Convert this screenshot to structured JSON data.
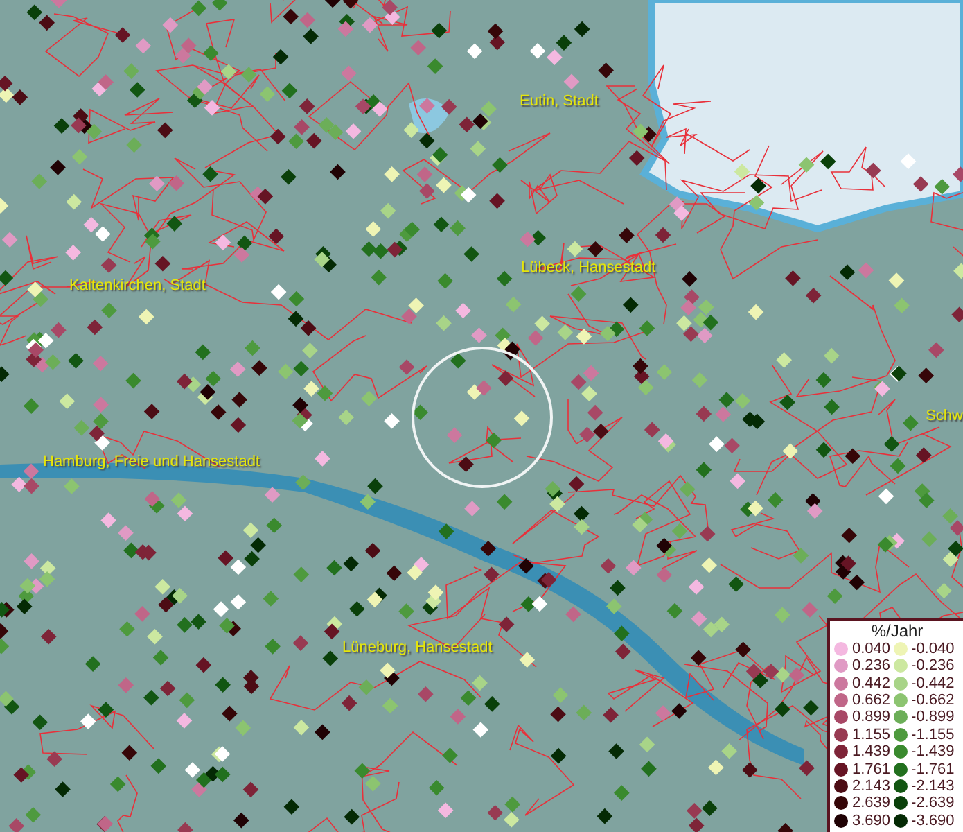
{
  "map": {
    "places": [
      {
        "name": "Eutin, Stadt"
      },
      {
        "name": "Lübeck, Hansestadt"
      },
      {
        "name": "Kaltenkirchen, Stadt"
      },
      {
        "name": "Hamburg, Freie und Hansestadt"
      },
      {
        "name": "Lüneburg, Hansestadt"
      },
      {
        "name": "Schw"
      }
    ]
  },
  "legend": {
    "title": "%/Jahr",
    "columns": [
      [
        {
          "label": "0.040",
          "color": "#f4b8e0"
        },
        {
          "label": "0.236",
          "color": "#e09ac4"
        },
        {
          "label": "0.442",
          "color": "#cc789e"
        },
        {
          "label": "0.662",
          "color": "#c06688"
        },
        {
          "label": "0.899",
          "color": "#a84866"
        },
        {
          "label": "1.155",
          "color": "#983a52"
        },
        {
          "label": "1.439",
          "color": "#7e2438"
        },
        {
          "label": "1.761",
          "color": "#661424"
        },
        {
          "label": "2.143",
          "color": "#4c0c14"
        },
        {
          "label": "2.639",
          "color": "#360608"
        },
        {
          "label": "3.690",
          "color": "#200204"
        }
      ],
      [
        {
          "label": "-0.040",
          "color": "#eef4b4"
        },
        {
          "label": "-0.236",
          "color": "#cce8a0"
        },
        {
          "label": "-0.442",
          "color": "#a8d488"
        },
        {
          "label": "-0.662",
          "color": "#8cc470"
        },
        {
          "label": "-0.899",
          "color": "#6cae58"
        },
        {
          "label": "-1.155",
          "color": "#4e9a3e"
        },
        {
          "label": "-1.439",
          "color": "#3a8a2e"
        },
        {
          "label": "-1.761",
          "color": "#22701e"
        },
        {
          "label": "-2.143",
          "color": "#125612"
        },
        {
          "label": "-2.639",
          "color": "#0a400a"
        },
        {
          "label": "-3.690",
          "color": "#042a04"
        }
      ]
    ]
  }
}
